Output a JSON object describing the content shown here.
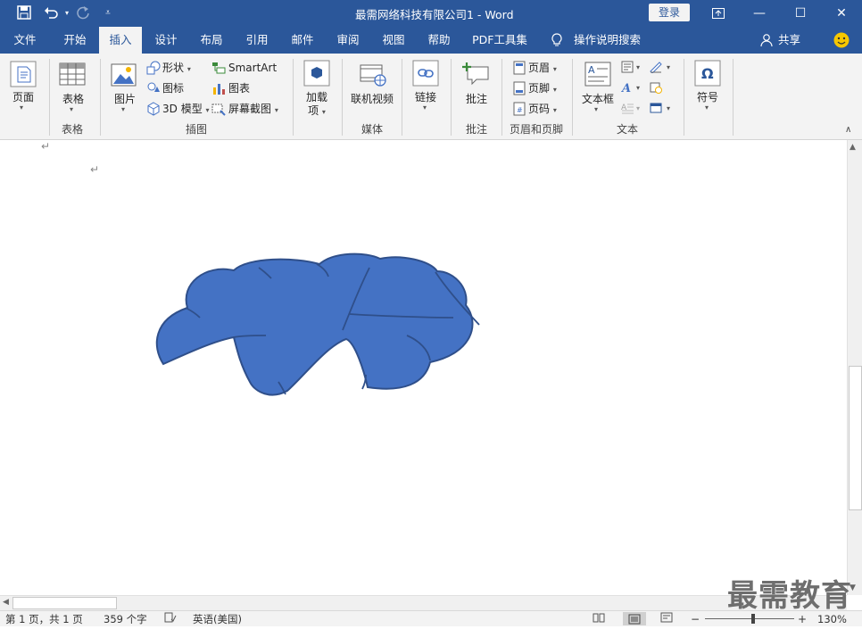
{
  "titlebar": {
    "title": "最需网络科技有限公司1  -  Word",
    "login": "登录"
  },
  "tabs": [
    "文件",
    "开始",
    "插入",
    "设计",
    "布局",
    "引用",
    "邮件",
    "审阅",
    "视图",
    "帮助",
    "PDF工具集"
  ],
  "active_tab": "插入",
  "tell_me": "操作说明搜索",
  "share": "共享",
  "ribbon": {
    "pages": {
      "label": "页面",
      "group": ""
    },
    "table": {
      "label": "表格",
      "group": "表格"
    },
    "illustrations": {
      "group": "插图",
      "pictures": "图片",
      "shapes": "形状",
      "icons": "图标",
      "models": "3D 模型",
      "smartart": "SmartArt",
      "chart": "图表",
      "screenshot": "屏幕截图"
    },
    "addins": {
      "label1": "加载",
      "label2": "项"
    },
    "media": {
      "label": "联机视频",
      "group": "媒体"
    },
    "links": {
      "label": "链接"
    },
    "comments": {
      "label": "批注",
      "group": "批注"
    },
    "header_footer": {
      "group": "页眉和页脚",
      "header": "页眉",
      "footer": "页脚",
      "page_number": "页码"
    },
    "text": {
      "group": "文本",
      "textbox": "文本框"
    },
    "symbols": {
      "label": "符号"
    }
  },
  "status": {
    "page": "第 1 页，共 1 页",
    "words": "359 个字",
    "language": "英语(美国)",
    "zoom": "130%"
  },
  "shape_color": "#4472c4",
  "accent_color": "#2b579a",
  "watermark": "最需教育"
}
